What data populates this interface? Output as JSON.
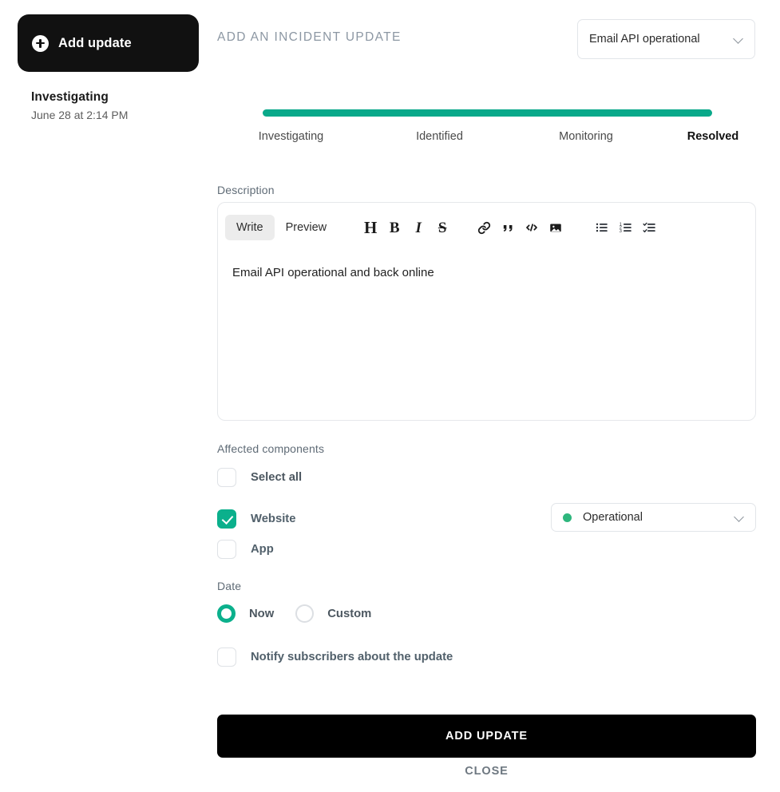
{
  "sidebar": {
    "add_update_button": "Add update",
    "add_icon": "plus-circle-icon",
    "history": {
      "status": "Investigating",
      "timestamp": "June 28 at 2:14 PM"
    }
  },
  "main": {
    "panel_title": "ADD AN INCIDENT UPDATE",
    "incident_select": {
      "value": "Email API operational",
      "chevron_icon": "chevron-down-icon"
    },
    "stepper": {
      "progress_percent": 100,
      "active_step": "Resolved",
      "steps": [
        {
          "label": "Investigating",
          "active": false
        },
        {
          "label": "Identified",
          "active": false
        },
        {
          "label": "Monitoring",
          "active": false
        },
        {
          "label": "Resolved",
          "active": true
        }
      ]
    },
    "description": {
      "label": "Description",
      "tabs": [
        {
          "label": "Write",
          "active": true
        },
        {
          "label": "Preview",
          "active": false
        }
      ],
      "toolbar_icons": [
        "heading-icon",
        "bold-icon",
        "italic-icon",
        "strikethrough-icon",
        "link-icon",
        "blockquote-icon",
        "code-icon",
        "image-icon",
        "bulleted-list-icon",
        "numbered-list-icon",
        "checklist-icon"
      ],
      "body_text": "Email API operational and back online"
    },
    "affected_components": {
      "label": "Affected components",
      "select_all": {
        "label": "Select all",
        "checked": false
      },
      "items": [
        {
          "label": "Website",
          "checked": true,
          "status": {
            "value": "Operational",
            "dot_color": "#2eb67d"
          }
        },
        {
          "label": "App",
          "checked": false,
          "status": null
        }
      ]
    },
    "date": {
      "label": "Date",
      "options": [
        {
          "label": "Now",
          "selected": true
        },
        {
          "label": "Custom",
          "selected": false
        }
      ]
    },
    "notify": {
      "label": "Notify subscribers about the update",
      "checked": false
    },
    "footer": {
      "primary_button": "ADD UPDATE",
      "secondary_button": "CLOSE"
    }
  },
  "colors": {
    "accent_green": "#0bb08c",
    "progress_green": "#09a98a",
    "status_dot": "#2eb67d",
    "dark_button": "#111111",
    "cta_button": "#000000"
  }
}
